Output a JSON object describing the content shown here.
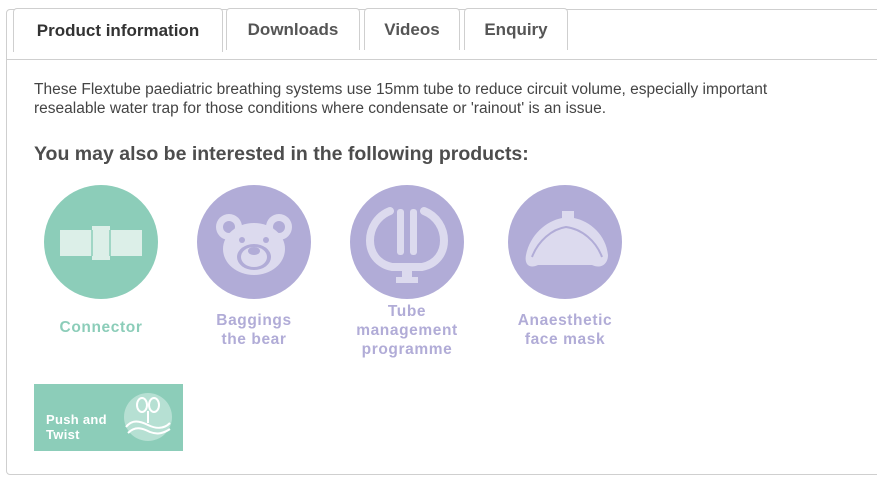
{
  "tabs": [
    {
      "label": "Product information",
      "active": true
    },
    {
      "label": "Downloads",
      "active": false
    },
    {
      "label": "Videos",
      "active": false
    },
    {
      "label": "Enquiry",
      "active": false
    }
  ],
  "description": {
    "line1": "These Flextube paediatric breathing systems use 15mm tube to reduce circuit volume, especially important",
    "line2": "resealable water trap for those conditions where condensate or 'rainout' is an issue."
  },
  "related": {
    "title": "You may also be interested in the following products:",
    "products": [
      {
        "label_lines": [
          "Connector"
        ],
        "color": "#8ccdb9",
        "icon": "connector-icon"
      },
      {
        "label_lines": [
          "Baggings",
          "the bear"
        ],
        "color": "#b1acd7",
        "icon": "bear-icon"
      },
      {
        "label_lines": [
          "Tube",
          "management",
          "programme"
        ],
        "color": "#b1acd7",
        "icon": "tube-management-icon"
      },
      {
        "label_lines": [
          "Anaesthetic",
          "face mask"
        ],
        "color": "#b1acd7",
        "icon": "face-mask-icon"
      }
    ]
  },
  "push_and_twist": {
    "line1": "Push and",
    "line2": "Twist",
    "color": "#8ccdb9",
    "icon": "push-twist-icon"
  }
}
